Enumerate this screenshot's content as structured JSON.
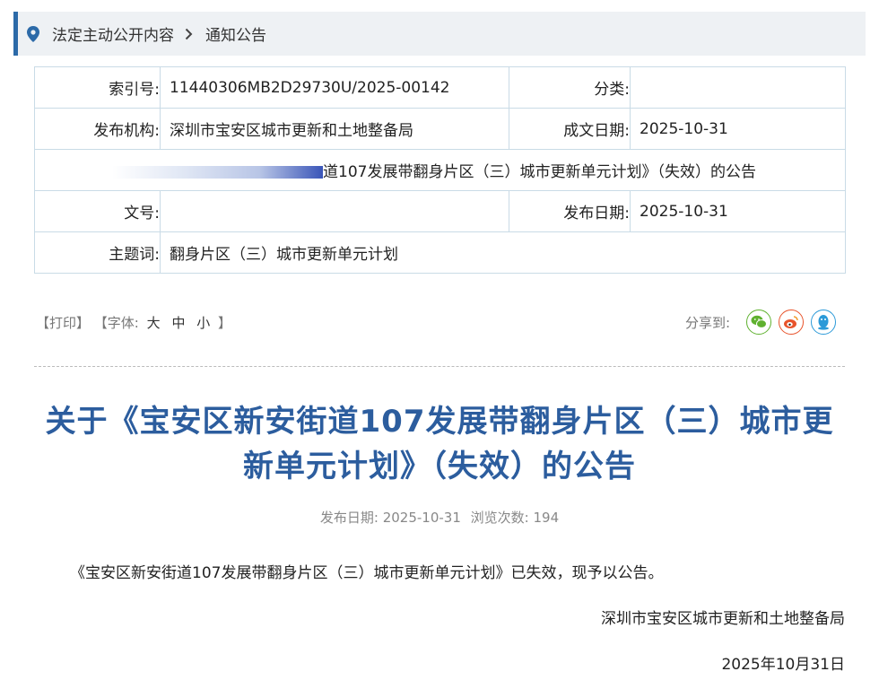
{
  "breadcrumb": {
    "icon": "location-pin-icon",
    "items": [
      "法定主动公开内容",
      "通知公告"
    ],
    "separator_icon": "chevron-right-icon"
  },
  "info": {
    "index_label": "索引号:",
    "index_value": "11440306MB2D29730U/2025-00142",
    "category_label": "分类:",
    "category_value": "",
    "publisher_label": "发布机构:",
    "publisher_value": "深圳市宝安区城市更新和土地整备局",
    "created_label": "成文日期:",
    "created_value": "2025-10-31",
    "name_value": "道107发展带翻身片区（三）城市更新单元计划》（失效）的公告",
    "docno_label": "文号:",
    "docno_value": "",
    "publish_label": "发布日期:",
    "publish_value": "2025-10-31",
    "keywords_label": "主题词:",
    "keywords_value": "翻身片区（三）城市更新单元计划"
  },
  "toolbar": {
    "print": "【打印】",
    "font_prefix": "【字体:",
    "size_large": "大",
    "size_medium": "中",
    "size_small": "小",
    "font_suffix": "】",
    "share_label": "分享到:"
  },
  "share_icons": [
    {
      "name": "wechat-icon",
      "color": "#5fb12f"
    },
    {
      "name": "weibo-icon",
      "color": "#e8542c"
    },
    {
      "name": "qq-icon",
      "color": "#2c9ad8"
    }
  ],
  "article": {
    "title_line1": "关于《宝安区新安街道107发展带翻身片区（三）城市更",
    "title_line2": "新单元计划》（失效）的公告",
    "meta_date_label": "发布日期:",
    "meta_date": "2025-10-31",
    "meta_views_label": "浏览次数:",
    "meta_views": "194",
    "body": "《宝安区新安街道107发展带翻身片区（三）城市更新单元计划》已失效，现予以公告。",
    "signature": "深圳市宝安区城市更新和土地整备局",
    "date": "2025年10月31日"
  },
  "colors": {
    "accent": "#2c6aa8",
    "title": "#2c5d9e",
    "border": "#c9dbe6"
  }
}
